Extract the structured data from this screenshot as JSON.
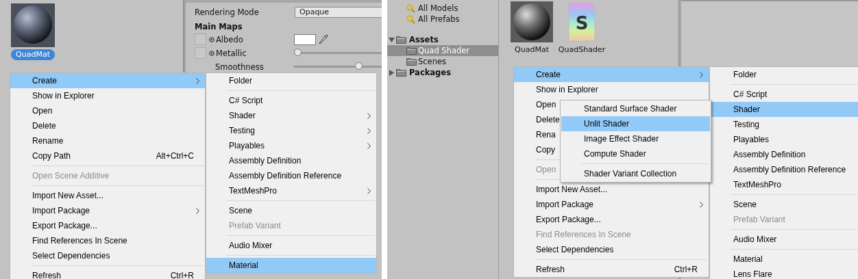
{
  "left": {
    "asset": {
      "name": "QuadMat",
      "selected": true
    },
    "inspector": {
      "rendering_mode": {
        "label": "Rendering Mode",
        "value": "Opaque"
      },
      "section": "Main Maps",
      "albedo": {
        "label": "Albedo"
      },
      "metallic": {
        "label": "Metallic",
        "level": 0
      },
      "smoothness": {
        "label": "Smoothness",
        "level": 0.5
      }
    },
    "context_menu": [
      {
        "kind": "item",
        "label": "Create",
        "selected": true,
        "disabled": false,
        "submenu": true
      },
      {
        "kind": "item",
        "label": "Show in Explorer",
        "selected": false,
        "disabled": false,
        "submenu": false
      },
      {
        "kind": "item",
        "label": "Open",
        "selected": false,
        "disabled": false,
        "submenu": false
      },
      {
        "kind": "item",
        "label": "Delete",
        "selected": false,
        "disabled": false,
        "submenu": false
      },
      {
        "kind": "item",
        "label": "Rename",
        "selected": false,
        "disabled": false,
        "submenu": false
      },
      {
        "kind": "item",
        "label": "Copy Path",
        "shortcut": "Alt+Ctrl+C",
        "selected": false,
        "disabled": false,
        "submenu": false
      },
      {
        "kind": "separator"
      },
      {
        "kind": "item",
        "label": "Open Scene Additive",
        "selected": false,
        "disabled": true,
        "submenu": false
      },
      {
        "kind": "separator"
      },
      {
        "kind": "item",
        "label": "Import New Asset...",
        "selected": false,
        "disabled": false,
        "submenu": false
      },
      {
        "kind": "item",
        "label": "Import Package",
        "selected": false,
        "disabled": false,
        "submenu": true
      },
      {
        "kind": "item",
        "label": "Export Package...",
        "selected": false,
        "disabled": false,
        "submenu": false
      },
      {
        "kind": "item",
        "label": "Find References In Scene",
        "selected": false,
        "disabled": false,
        "submenu": false
      },
      {
        "kind": "item",
        "label": "Select Dependencies",
        "selected": false,
        "disabled": false,
        "submenu": false
      },
      {
        "kind": "separator"
      },
      {
        "kind": "item",
        "label": "Refresh",
        "shortcut": "Ctrl+R",
        "selected": false,
        "disabled": false,
        "submenu": false
      }
    ],
    "create_submenu": [
      {
        "kind": "item",
        "label": "Folder",
        "selected": false,
        "disabled": false,
        "submenu": false
      },
      {
        "kind": "separator"
      },
      {
        "kind": "item",
        "label": "C# Script",
        "selected": false,
        "disabled": false,
        "submenu": false
      },
      {
        "kind": "item",
        "label": "Shader",
        "selected": false,
        "disabled": false,
        "submenu": true
      },
      {
        "kind": "item",
        "label": "Testing",
        "selected": false,
        "disabled": false,
        "submenu": true
      },
      {
        "kind": "item",
        "label": "Playables",
        "selected": false,
        "disabled": false,
        "submenu": true
      },
      {
        "kind": "item",
        "label": "Assembly Definition",
        "selected": false,
        "disabled": false,
        "submenu": false
      },
      {
        "kind": "item",
        "label": "Assembly Definition Reference",
        "selected": false,
        "disabled": false,
        "submenu": false
      },
      {
        "kind": "item",
        "label": "TextMeshPro",
        "selected": false,
        "disabled": false,
        "submenu": true
      },
      {
        "kind": "separator"
      },
      {
        "kind": "item",
        "label": "Scene",
        "selected": false,
        "disabled": false,
        "submenu": false
      },
      {
        "kind": "item",
        "label": "Prefab Variant",
        "selected": false,
        "disabled": true,
        "submenu": false
      },
      {
        "kind": "separator"
      },
      {
        "kind": "item",
        "label": "Audio Mixer",
        "selected": false,
        "disabled": false,
        "submenu": false
      },
      {
        "kind": "separator"
      },
      {
        "kind": "item",
        "label": "Material",
        "selected": true,
        "disabled": false,
        "submenu": false
      }
    ]
  },
  "right": {
    "tree": [
      {
        "kind": "search",
        "label": "All Models",
        "selected": false
      },
      {
        "kind": "search",
        "label": "All Prefabs",
        "selected": false
      },
      {
        "kind": "folder",
        "label": "Assets",
        "selected": false,
        "expanded": true,
        "children": [
          {
            "kind": "folder",
            "label": "Quad Shader",
            "selected": true
          },
          {
            "kind": "folder",
            "label": "Scenes",
            "selected": false
          }
        ]
      },
      {
        "kind": "folder",
        "label": "Packages",
        "selected": false,
        "expanded": false
      }
    ],
    "assets": [
      {
        "kind": "material",
        "name": "QuadMat",
        "selected": false
      },
      {
        "kind": "shader",
        "name": "QuadShader",
        "glyph": "S",
        "selected": false
      }
    ],
    "context_menu": [
      {
        "kind": "item",
        "label": "Create",
        "selected": true,
        "disabled": false,
        "submenu": true
      },
      {
        "kind": "item",
        "label": "Show in Explorer",
        "selected": false,
        "disabled": false,
        "submenu": false
      },
      {
        "kind": "item",
        "label": "Open",
        "selected": false,
        "disabled": false
      },
      {
        "kind": "item",
        "label": "Delete",
        "selected": false,
        "disabled": false
      },
      {
        "kind": "item",
        "label": "Rena",
        "selected": false,
        "disabled": false
      },
      {
        "kind": "item",
        "label": "Copy",
        "selected": false,
        "disabled": false
      },
      {
        "kind": "separator"
      },
      {
        "kind": "item",
        "label": "Open",
        "selected": false,
        "disabled": true,
        "submenu": false
      },
      {
        "kind": "separator"
      },
      {
        "kind": "item",
        "label": "Import New Asset...",
        "selected": false,
        "disabled": false,
        "submenu": false
      },
      {
        "kind": "item",
        "label": "Import Package",
        "selected": false,
        "disabled": false,
        "submenu": true
      },
      {
        "kind": "item",
        "label": "Export Package...",
        "selected": false,
        "disabled": false,
        "submenu": false
      },
      {
        "kind": "item",
        "label": "Find References In Scene",
        "selected": false,
        "disabled": true,
        "submenu": false
      },
      {
        "kind": "item",
        "label": "Select Dependencies",
        "selected": false,
        "disabled": false,
        "submenu": false
      },
      {
        "kind": "separator"
      },
      {
        "kind": "item",
        "label": "Refresh",
        "shortcut": "Ctrl+R",
        "selected": false,
        "disabled": false,
        "submenu": false
      }
    ],
    "shader_submenu": [
      {
        "kind": "item",
        "label": "Standard Surface Shader",
        "selected": false,
        "disabled": false,
        "submenu": false
      },
      {
        "kind": "item",
        "label": "Unlit Shader",
        "selected": true,
        "disabled": false,
        "submenu": false
      },
      {
        "kind": "item",
        "label": "Image Effect Shader",
        "selected": false,
        "disabled": false,
        "submenu": false
      },
      {
        "kind": "item",
        "label": "Compute Shader",
        "selected": false,
        "disabled": false,
        "submenu": false
      },
      {
        "kind": "separator"
      },
      {
        "kind": "item",
        "label": "Shader Variant Collection",
        "selected": false,
        "disabled": false,
        "submenu": false
      }
    ],
    "create_submenu": [
      {
        "kind": "item",
        "label": "Folder",
        "selected": false,
        "disabled": false
      },
      {
        "kind": "separator"
      },
      {
        "kind": "item",
        "label": "C# Script",
        "selected": false,
        "disabled": false
      },
      {
        "kind": "item",
        "label": "Shader",
        "selected": true,
        "disabled": false
      },
      {
        "kind": "item",
        "label": "Testing",
        "selected": false,
        "disabled": false
      },
      {
        "kind": "item",
        "label": "Playables",
        "selected": false,
        "disabled": false
      },
      {
        "kind": "item",
        "label": "Assembly Definition",
        "selected": false,
        "disabled": false
      },
      {
        "kind": "item",
        "label": "Assembly Definition Reference",
        "selected": false,
        "disabled": false
      },
      {
        "kind": "item",
        "label": "TextMeshPro",
        "selected": false,
        "disabled": false
      },
      {
        "kind": "separator"
      },
      {
        "kind": "item",
        "label": "Scene",
        "selected": false,
        "disabled": false
      },
      {
        "kind": "item",
        "label": "Prefab Variant",
        "selected": false,
        "disabled": true
      },
      {
        "kind": "separator"
      },
      {
        "kind": "item",
        "label": "Audio Mixer",
        "selected": false,
        "disabled": false
      },
      {
        "kind": "separator"
      },
      {
        "kind": "item",
        "label": "Material",
        "selected": false,
        "disabled": false
      },
      {
        "kind": "item",
        "label": "Lens Flare",
        "selected": false,
        "disabled": false
      }
    ]
  }
}
